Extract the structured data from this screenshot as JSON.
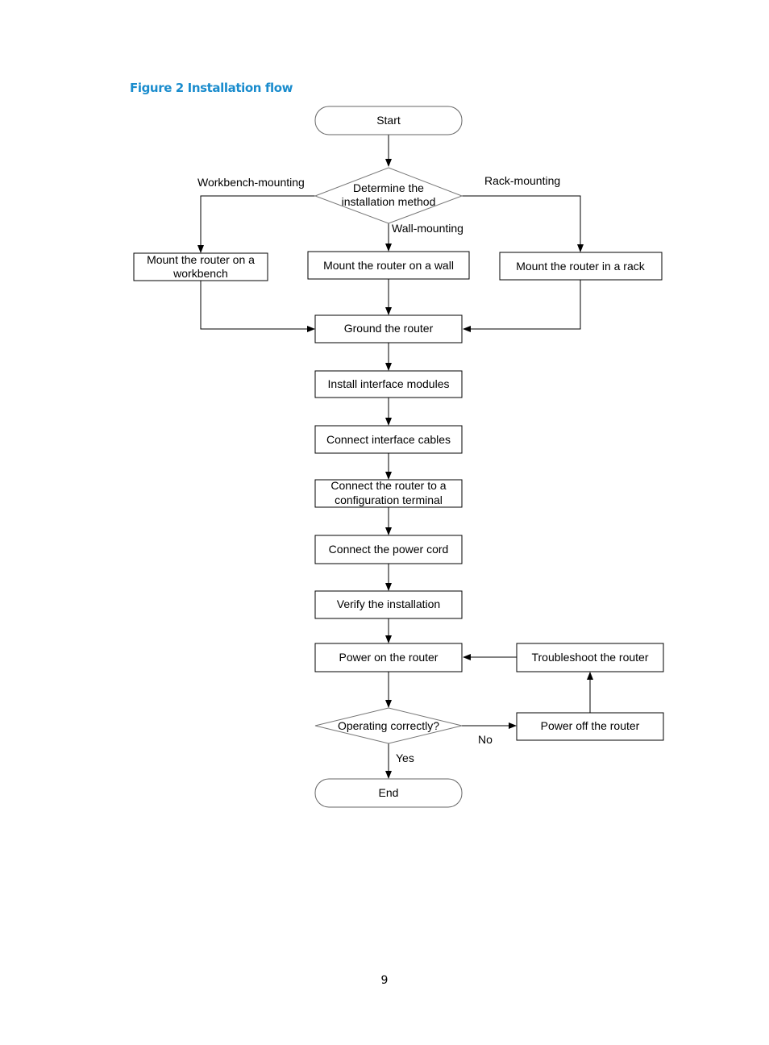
{
  "figure": {
    "caption": "Figure 2 Installation flow"
  },
  "nodes": {
    "start": {
      "type": "terminal",
      "lines": [
        "Start"
      ]
    },
    "determine": {
      "type": "decision",
      "lines": [
        "Determine the",
        "installation method"
      ]
    },
    "workbench": {
      "type": "process",
      "lines": [
        "Mount the router on a",
        "workbench"
      ]
    },
    "wall": {
      "type": "process",
      "lines": [
        "Mount the router on a wall"
      ]
    },
    "rack": {
      "type": "process",
      "lines": [
        "Mount the router in a rack"
      ]
    },
    "ground": {
      "type": "process",
      "lines": [
        "Ground the router"
      ]
    },
    "modules": {
      "type": "process",
      "lines": [
        "Install interface modules"
      ]
    },
    "cables": {
      "type": "process",
      "lines": [
        "Connect interface cables"
      ]
    },
    "terminal": {
      "type": "process",
      "lines": [
        "Connect the router to a",
        "configuration terminal"
      ]
    },
    "power_cord": {
      "type": "process",
      "lines": [
        "Connect the power cord"
      ]
    },
    "verify": {
      "type": "process",
      "lines": [
        "Verify the installation"
      ]
    },
    "power_on": {
      "type": "process",
      "lines": [
        "Power on the router"
      ]
    },
    "operating": {
      "type": "decision",
      "lines": [
        "Operating correctly?"
      ]
    },
    "power_off": {
      "type": "process",
      "lines": [
        "Power off the router"
      ]
    },
    "troubleshoot": {
      "type": "process",
      "lines": [
        "Troubleshoot the router"
      ]
    },
    "end": {
      "type": "terminal",
      "lines": [
        "End"
      ]
    }
  },
  "edges": [
    {
      "from": "start",
      "to": "determine",
      "label": ""
    },
    {
      "from": "determine",
      "to": "workbench",
      "label": "Workbench-mounting"
    },
    {
      "from": "determine",
      "to": "wall",
      "label": "Wall-mounting"
    },
    {
      "from": "determine",
      "to": "rack",
      "label": "Rack-mounting"
    },
    {
      "from": "workbench",
      "to": "ground",
      "label": ""
    },
    {
      "from": "wall",
      "to": "ground",
      "label": ""
    },
    {
      "from": "rack",
      "to": "ground",
      "label": ""
    },
    {
      "from": "ground",
      "to": "modules",
      "label": ""
    },
    {
      "from": "modules",
      "to": "cables",
      "label": ""
    },
    {
      "from": "cables",
      "to": "terminal",
      "label": ""
    },
    {
      "from": "terminal",
      "to": "power_cord",
      "label": ""
    },
    {
      "from": "power_cord",
      "to": "verify",
      "label": ""
    },
    {
      "from": "verify",
      "to": "power_on",
      "label": ""
    },
    {
      "from": "power_on",
      "to": "operating",
      "label": ""
    },
    {
      "from": "operating",
      "to": "end",
      "label": "Yes"
    },
    {
      "from": "operating",
      "to": "power_off",
      "label": "No"
    },
    {
      "from": "power_off",
      "to": "troubleshoot",
      "label": ""
    },
    {
      "from": "troubleshoot",
      "to": "power_on",
      "label": ""
    }
  ],
  "labels": {
    "workbench_mounting": "Workbench-mounting",
    "wall_mounting": "Wall-mounting",
    "rack_mounting": "Rack-mounting",
    "yes": "Yes",
    "no": "No"
  },
  "page": {
    "number": "9"
  }
}
